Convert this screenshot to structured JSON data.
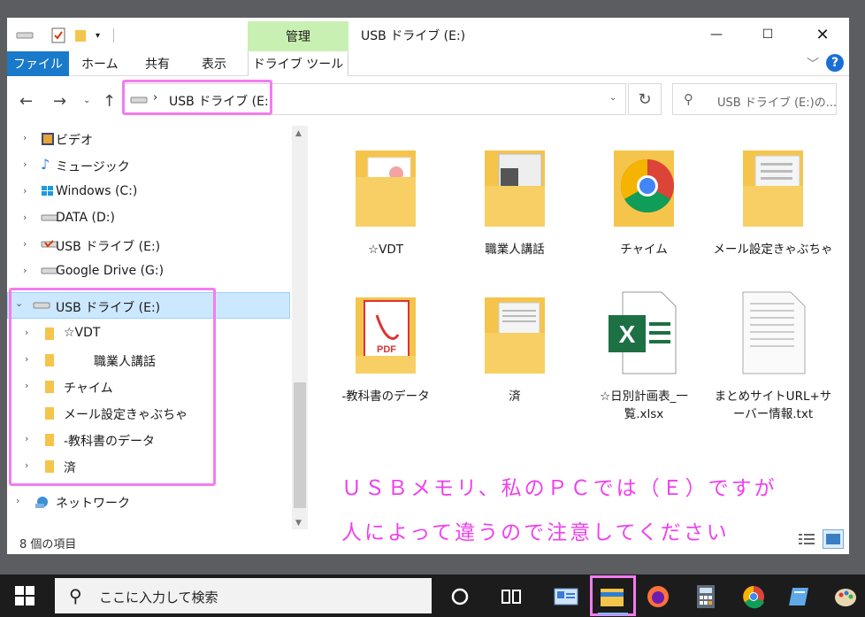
{
  "window": {
    "title": "USB ドライブ (E:)",
    "manage_tab": "管理",
    "minimize_glyph": "—",
    "maximize_glyph": "☐",
    "close_glyph": "✕"
  },
  "ribbon": {
    "tabs": [
      "ファイル",
      "ホーム",
      "共有",
      "表示",
      "ドライブ ツール"
    ],
    "help_label": "?"
  },
  "address": {
    "path": "USB ドライブ (E:)",
    "search_placeholder": "USB ドライブ (E:)の..."
  },
  "nav_tree": [
    {
      "label": "ビデオ",
      "icon": "video-icon",
      "expand": "›"
    },
    {
      "label": "ミュージック",
      "icon": "music-icon",
      "expand": "›"
    },
    {
      "label": "Windows (C:)",
      "icon": "windows-drive-icon",
      "expand": "›"
    },
    {
      "label": "DATA (D:)",
      "icon": "drive-icon",
      "expand": "›"
    },
    {
      "label": "USB ドライブ (E:)",
      "icon": "usb-drive-icon",
      "expand": "›"
    },
    {
      "label": "Google Drive (G:)",
      "icon": "drive-icon",
      "expand": "›"
    },
    {
      "label": "USB ドライブ (E:)",
      "icon": "drive-icon",
      "expand": "⌄",
      "selected": true
    },
    {
      "label": "☆VDT",
      "icon": "folder-icon",
      "expand": "›"
    },
    {
      "label": "職業人講話",
      "icon": "folder-icon",
      "expand": "›"
    },
    {
      "label": "チャイム",
      "icon": "folder-icon",
      "expand": "›"
    },
    {
      "label": "メール設定きゃぶちゃ",
      "icon": "folder-icon",
      "expand": ""
    },
    {
      "label": "-教科書のデータ",
      "icon": "folder-icon",
      "expand": "›"
    },
    {
      "label": "済",
      "icon": "folder-icon",
      "expand": "›"
    },
    {
      "label": "ネットワーク",
      "icon": "network-icon",
      "expand": "›"
    }
  ],
  "status": {
    "item_count": "8 個の項目"
  },
  "files": [
    {
      "name": "☆VDT",
      "type": "folder"
    },
    {
      "name": "職業人講話",
      "type": "folder"
    },
    {
      "name": "チャイム",
      "type": "folder"
    },
    {
      "name": "メール設定きゃぶちゃ",
      "type": "folder"
    },
    {
      "name": "-教科書のデータ",
      "type": "folder"
    },
    {
      "name": "済",
      "type": "folder"
    },
    {
      "name": "☆日別計画表_一覧.xlsx",
      "type": "xlsx"
    },
    {
      "name": "まとめサイトURL+サーバー情報.txt",
      "type": "txt"
    }
  ],
  "annotation": {
    "line1": "ＵＳＢメモリ、私のＰＣでは（Ｅ）ですが",
    "line2": "人によって違うので注意してください"
  },
  "taskbar": {
    "search_placeholder": "ここに入力して検索",
    "apps": [
      "cortana-icon",
      "task-view-icon",
      "control-panel-icon",
      "file-explorer-icon",
      "firefox-icon",
      "calculator-icon",
      "chrome-icon",
      "notepad-icon",
      "paint-icon"
    ]
  },
  "colors": {
    "accent": "#1979ca",
    "manage_tab": "#c9f0b3",
    "highlight": "#f37cf0",
    "annotation": "#f03ff0",
    "selection": "#cce8ff",
    "folder": "#f5c44b"
  }
}
